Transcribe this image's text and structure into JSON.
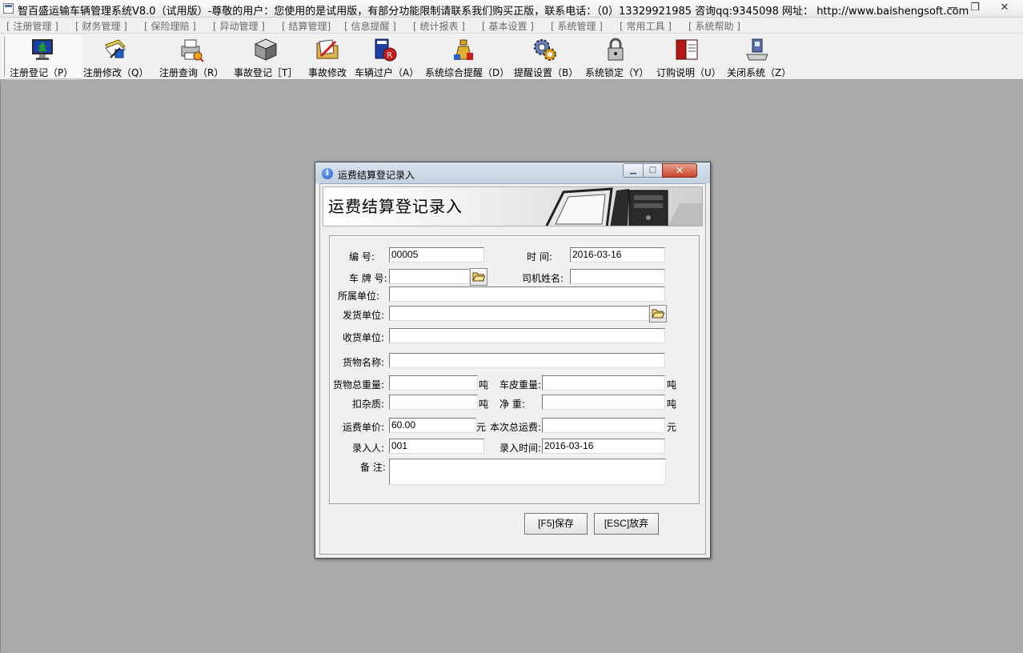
{
  "app": {
    "title": "智百盛运输车辆管理系统V8.0（试用版）-尊敬的用户：您使用的是试用版，有部分功能限制请联系我们购买正版，联系电话：（0）13329921985  咨询qq:9345098   网址： http://www.baishengsoft.com",
    "min_glyph": "—",
    "max_glyph": "❐",
    "close_glyph": "✕"
  },
  "menu": {
    "items": [
      "[ 注册管理 ]",
      "[ 财务管理 ]",
      "[ 保险理赔 ]",
      "[ 异动管理 ]",
      "[ 结算管理]",
      "[ 信息提醒 ]",
      "[ 统计报表 ]",
      "[ 基本设置 ]",
      "[ 系统管理 ]",
      "[ 常用工具 ]",
      "[ 系统帮助 ]"
    ]
  },
  "toolbar": {
    "buttons": [
      {
        "label": "注册登记（P）",
        "icon": "monitor-tree-icon"
      },
      {
        "label": "注册修改（Q）",
        "icon": "edit-document-icon"
      },
      {
        "label": "注册查询（R）",
        "icon": "query-printer-icon"
      },
      {
        "label": "事故登记［T］",
        "icon": "package-box-icon"
      },
      {
        "label": "事故修改",
        "icon": "folder-edit-icon"
      },
      {
        "label": "车辆过户（A）",
        "icon": "transfer-book-icon"
      },
      {
        "label": "系统综合提醒（D）",
        "icon": "reminder-bell-icon"
      },
      {
        "label": "提醒设置（B）",
        "icon": "settings-gear-icon"
      },
      {
        "label": "系统锁定（Y）",
        "icon": "lock-icon"
      },
      {
        "label": "订购说明（U）",
        "icon": "order-book-icon"
      },
      {
        "label": "关闭系统（Z）",
        "icon": "shutdown-computer-icon"
      }
    ]
  },
  "dialog": {
    "title": "运费结算登记录入",
    "banner_title": "运费结算登记录入",
    "info_glyph": "i",
    "min_glyph": "▁",
    "max_glyph": "□",
    "close_glyph": "✕",
    "fields": {
      "number": {
        "label": "编    号:",
        "value": "00005"
      },
      "time": {
        "label": "时    间:",
        "value": "2016-03-16"
      },
      "plate": {
        "label": "车 牌 号:",
        "value": ""
      },
      "driver": {
        "label": "司机姓名:",
        "value": ""
      },
      "unit": {
        "label": "所属单位:",
        "value": ""
      },
      "shipper": {
        "label": "发货单位:",
        "value": ""
      },
      "receiver": {
        "label": "收货单位:",
        "value": ""
      },
      "goods_name": {
        "label": "货物名称:",
        "value": ""
      },
      "gross_weight": {
        "label": "货物总重量:",
        "value": "",
        "unit": "吨"
      },
      "tare_weight": {
        "label": "车皮重量:",
        "value": "",
        "unit": "吨"
      },
      "impurity": {
        "label": "扣杂质:",
        "value": "",
        "unit": "吨"
      },
      "net_weight": {
        "label": "净    重:",
        "value": "",
        "unit": "吨"
      },
      "unit_price": {
        "label": "运费单价:",
        "value": "60.00",
        "unit": "元"
      },
      "total_fee": {
        "label": "本次总运费:",
        "value": "",
        "unit": "元"
      },
      "entered_by": {
        "label": "录入人:",
        "value": "001"
      },
      "entry_time": {
        "label": "录入时间:",
        "value": "2016-03-16"
      },
      "remark": {
        "label": "备 注:",
        "value": ""
      }
    },
    "buttons": {
      "save": "[F5]保存",
      "cancel": "[ESC]放弃"
    }
  }
}
